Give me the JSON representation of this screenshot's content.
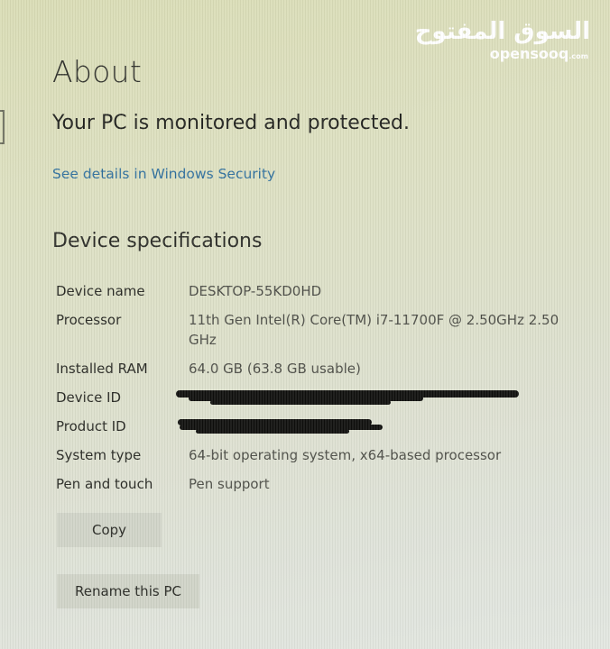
{
  "watermark": {
    "arabic": "السوق المفتوح",
    "latin": "opensooq",
    "suffix": ".com"
  },
  "page": {
    "title": "About",
    "protection_status": "Your PC is monitored and protected.",
    "security_link": "See details in Windows Security"
  },
  "device_specs": {
    "section_title": "Device specifications",
    "rows": [
      {
        "label": "Device name",
        "value": "DESKTOP-55KD0HD"
      },
      {
        "label": "Processor",
        "value": "11th Gen Intel(R) Core(TM) i7-11700F @ 2.50GHz   2.50 GHz"
      },
      {
        "label": "Installed RAM",
        "value": "64.0 GB (63.8 GB usable)"
      },
      {
        "label": "Device ID",
        "value": "[redacted]"
      },
      {
        "label": "Product ID",
        "value": "[redacted]"
      },
      {
        "label": "System type",
        "value": "64-bit operating system, x64-based processor"
      },
      {
        "label": "Pen and touch",
        "value": "Pen support"
      }
    ]
  },
  "buttons": {
    "copy": "Copy",
    "rename": "Rename this PC"
  }
}
